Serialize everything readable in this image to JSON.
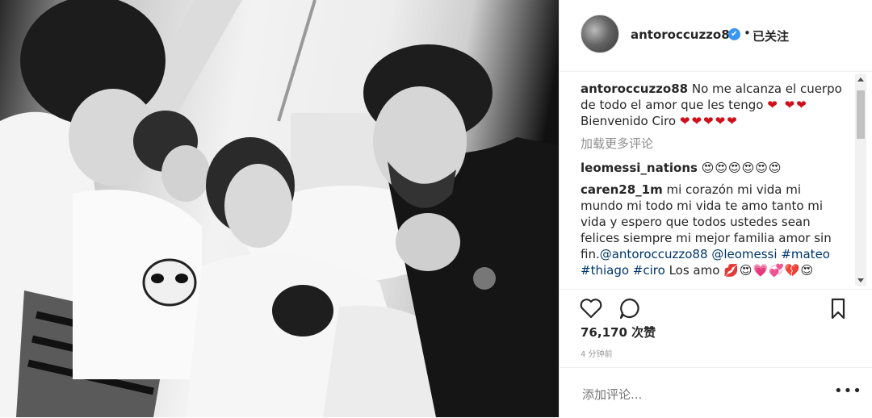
{
  "post": {
    "username": "antoroccuzzo88",
    "verified_mark": "✔",
    "separator": "•",
    "follow_status": "已关注"
  },
  "caption": {
    "username": "antoroccuzzo88",
    "text_line1": "No me alcanza el cuerpo de todo el amor que les tengo",
    "hearts1": "❤ ❤❤",
    "text_line2": "Bienvenido Ciro",
    "hearts2": "❤❤❤❤❤"
  },
  "load_more": "加载更多评论",
  "comments": [
    {
      "username": "leomessi_nations",
      "emojis": "😍😍😍😍😍😍"
    },
    {
      "username": "caren28_1m",
      "text": "mi corazón mi vida mi mundo mi todo mi vida te amo tanto mi vida y espero que todos ustedes sean felices siempre mi mejor familia amor sin fin.",
      "mention1": "@antoroccuzzo88",
      "mention2": "@leomessi",
      "tag1": "#mateo",
      "tag2": "#thiago",
      "tag3": "#ciro",
      "text_end": "Los amo",
      "emojis": "💋😍💗💞💔😍"
    }
  ],
  "icons": [
    "heart-icon",
    "comment-icon",
    "bookmark-icon",
    "more-icon"
  ],
  "likes": "76,170 次赞",
  "timestamp": "4 分钟前",
  "add_comment_placeholder": "添加评论...",
  "more_options": "•••",
  "colors": {
    "link": "#003569",
    "verified": "#3897f0",
    "muted": "#8e8e8e",
    "heart": "#d10f1a"
  }
}
